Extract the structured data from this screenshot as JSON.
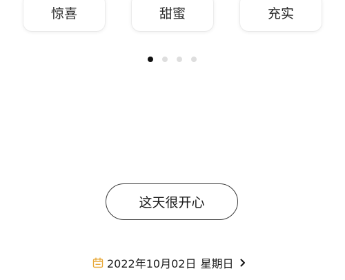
{
  "mood_options": [
    "惊喜",
    "甜蜜",
    "充实"
  ],
  "pager": {
    "total": 4,
    "active_index": 0
  },
  "confirm_button": {
    "label": "这天很开心"
  },
  "date_selector": {
    "date": "2022年10月02日",
    "weekday": "星期日"
  },
  "colors": {
    "calendar_icon": "#E8A93A",
    "active_dot": "#111111",
    "inactive_dot": "#DEDEDE"
  },
  "icons": {
    "calendar": "calendar-icon",
    "chevron": "chevron-right-icon"
  }
}
